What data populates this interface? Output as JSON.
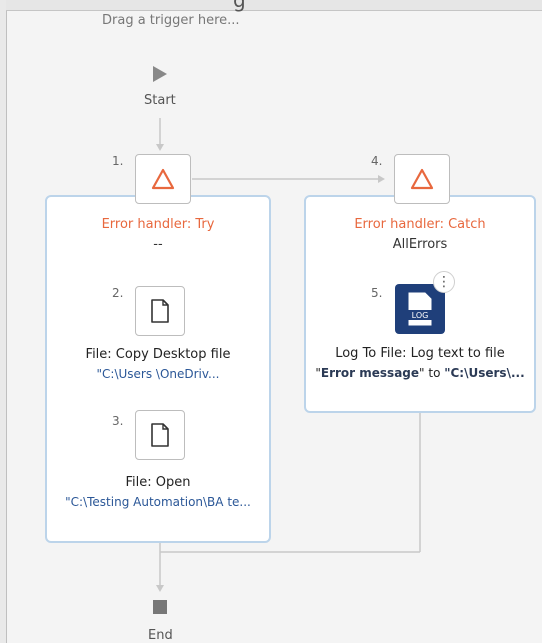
{
  "top_partial_text": "g",
  "trigger_placeholder": "Drag a trigger here...",
  "start_label": "Start",
  "end_label": "End",
  "steps": {
    "s1_num": "1.",
    "s2_num": "2.",
    "s3_num": "3.",
    "s4_num": "4.",
    "s5_num": "5."
  },
  "try_card": {
    "title": "Error handler: Try",
    "subtitle": "--",
    "action1": {
      "title": "File: Copy Desktop file",
      "path": "\"C:\\Users \\OneDriv..."
    },
    "action2": {
      "title": "File: Open",
      "path": "\"C:\\Testing Automation\\BA te..."
    }
  },
  "catch_card": {
    "title": "Error handler: Catch",
    "subtitle": "AllErrors",
    "action": {
      "title": "Log To File: Log text to file",
      "path_quote_open": "\"",
      "path_bold1": "Error message",
      "path_quote_close": "\"",
      "path_to": " to ",
      "path_bold2": "\"C:\\Users\\...",
      "icon_text": "LOG"
    },
    "kebab_label": "⋮"
  },
  "icons": {
    "start": "play-icon",
    "end": "stop-icon",
    "error_handler": "warning-triangle-icon",
    "file": "document-icon",
    "log": "log-file-icon"
  },
  "colors": {
    "accent_orange": "#e8683e",
    "card_border": "#bcd4ea",
    "link_blue": "#2b5797",
    "log_tile": "#1f3f7a"
  }
}
